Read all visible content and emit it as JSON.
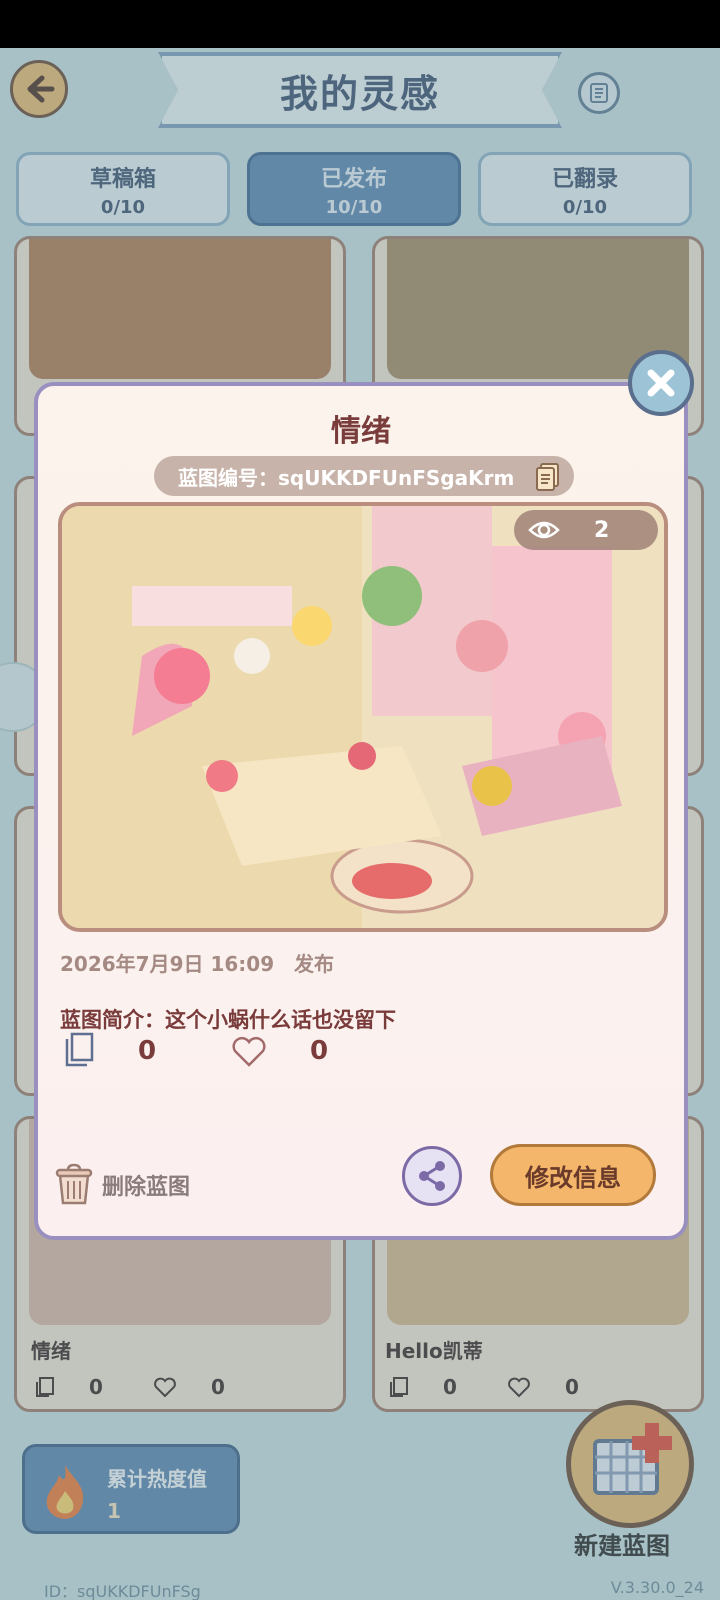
{
  "header": {
    "title": "我的灵感"
  },
  "tabs": [
    {
      "label": "草稿箱",
      "count": "0/10"
    },
    {
      "label": "已发布",
      "count": "10/10"
    },
    {
      "label": "已翻录",
      "count": "0/10"
    }
  ],
  "active_tab": 1,
  "cards": [
    {
      "name": "情绪",
      "copies": "0",
      "likes": "0"
    },
    {
      "name": "Hello凯蒂",
      "copies": "0",
      "likes": "0"
    }
  ],
  "heat": {
    "label": "累计热度值",
    "value": "1"
  },
  "new_blueprint_label": "新建蓝图",
  "footer": {
    "id": "ID：sqUKKDFUnFSg",
    "version": "V.3.30.0_24"
  },
  "modal": {
    "title": "情绪",
    "code": "蓝图编号：sqUKKDFUnFSgaKrm",
    "views": "2",
    "date": "2026年7月9日 16:09",
    "status": "发布",
    "description": "蓝图简介：这个小蜗什么话也没留下",
    "copies": "0",
    "likes": "0",
    "delete_label": "删除蓝图",
    "edit_label": "修改信息"
  },
  "colors": {
    "accent": "#5d86b1",
    "button": "#f4b66a",
    "title": "#3c5071",
    "modal_border": "#9a90c0"
  }
}
